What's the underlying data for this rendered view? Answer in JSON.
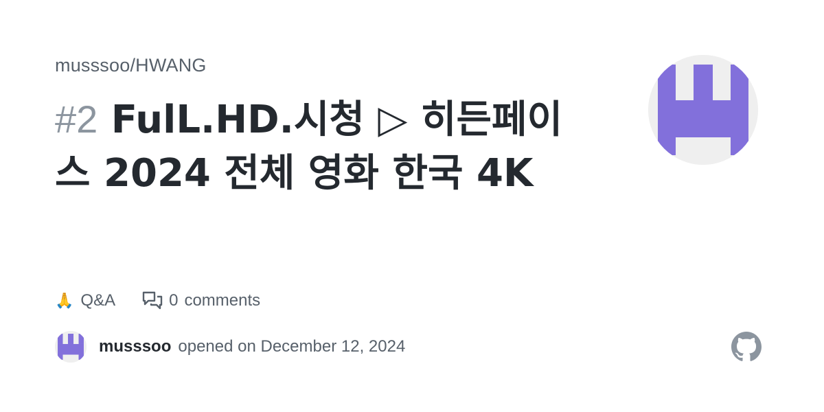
{
  "repo": "musssoo/HWANG",
  "issue": {
    "number": "#2",
    "title": "FulL.HD.시청 ▷ 히든페이스 2024 전체 영화 한국 4K"
  },
  "meta": {
    "category_emoji": "🙏",
    "category": "Q&A",
    "comment_count": "0",
    "comment_label": "comments"
  },
  "author": {
    "name": "musssoo",
    "action": "opened on December 12, 2024"
  },
  "colors": {
    "avatar_purple": "#8270db",
    "avatar_bg": "#efefef",
    "text_primary": "#24292f",
    "text_muted": "#57606a",
    "issue_number": "#8c959f",
    "github_logo": "#8c959f"
  },
  "icons": {
    "comment": "comment-discussion-icon",
    "logo": "github-mark-icon"
  }
}
